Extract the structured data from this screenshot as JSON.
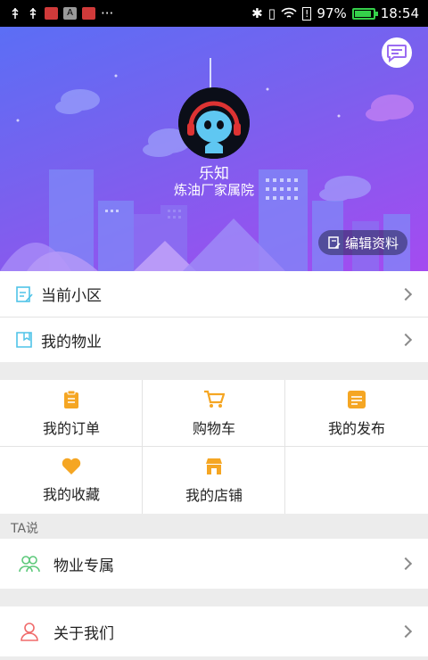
{
  "status_bar": {
    "battery": "97%",
    "time": "18:54",
    "battery_color": "#35d04a"
  },
  "header": {
    "username": "乐知",
    "community": "炼油厂家属院",
    "edit_label": "编辑资料",
    "message_icon": "chat-bubble-icon",
    "gradient_start": "#5b6ef5",
    "gradient_end": "#a44bf0"
  },
  "list_top": [
    {
      "label": "当前小区",
      "icon": "edit-note-icon"
    },
    {
      "label": "我的物业",
      "icon": "bookmark-icon"
    }
  ],
  "grid": [
    {
      "label": "我的订单",
      "icon": "clipboard-icon"
    },
    {
      "label": "购物车",
      "icon": "cart-icon"
    },
    {
      "label": "我的发布",
      "icon": "post-icon"
    },
    {
      "label": "我的收藏",
      "icon": "heart-icon"
    },
    {
      "label": "我的店铺",
      "icon": "shop-icon"
    }
  ],
  "section": {
    "title": "TA说"
  },
  "list_bottom": [
    {
      "label": "物业专属",
      "icon": "people-icon"
    },
    {
      "label": "关于我们",
      "icon": "person-icon"
    }
  ],
  "colors": {
    "accent_orange": "#f5a623",
    "icon_teal": "#4fc3e8",
    "icon_green": "#5cc97a",
    "icon_red": "#f06a6a"
  }
}
